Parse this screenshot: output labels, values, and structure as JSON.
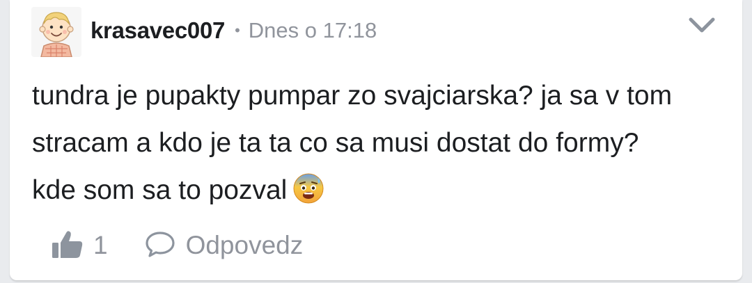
{
  "comment": {
    "author": "krasavec007",
    "separator": "•",
    "timestamp": "Dnes o 17:18",
    "text_lines": [
      "tundra je pupakty pumpar zo svajciarska? ja sa v tom",
      "stracam a kdo je ta ta co sa musi dostat do formy?",
      "kde som sa to pozval"
    ],
    "emoji": "anxious-face-with-sweat",
    "likes": "1",
    "reply_label": "Odpovedz"
  },
  "colors": {
    "background": "#e9ebee",
    "card": "#ffffff",
    "text": "#1c1e21",
    "muted": "#90949c",
    "icon": "#8d949e"
  },
  "icons": {
    "avatar": "cartoon-boy-avatar",
    "menu": "chevron-down-icon",
    "like": "thumbs-up-icon",
    "reply": "speech-bubble-icon"
  }
}
